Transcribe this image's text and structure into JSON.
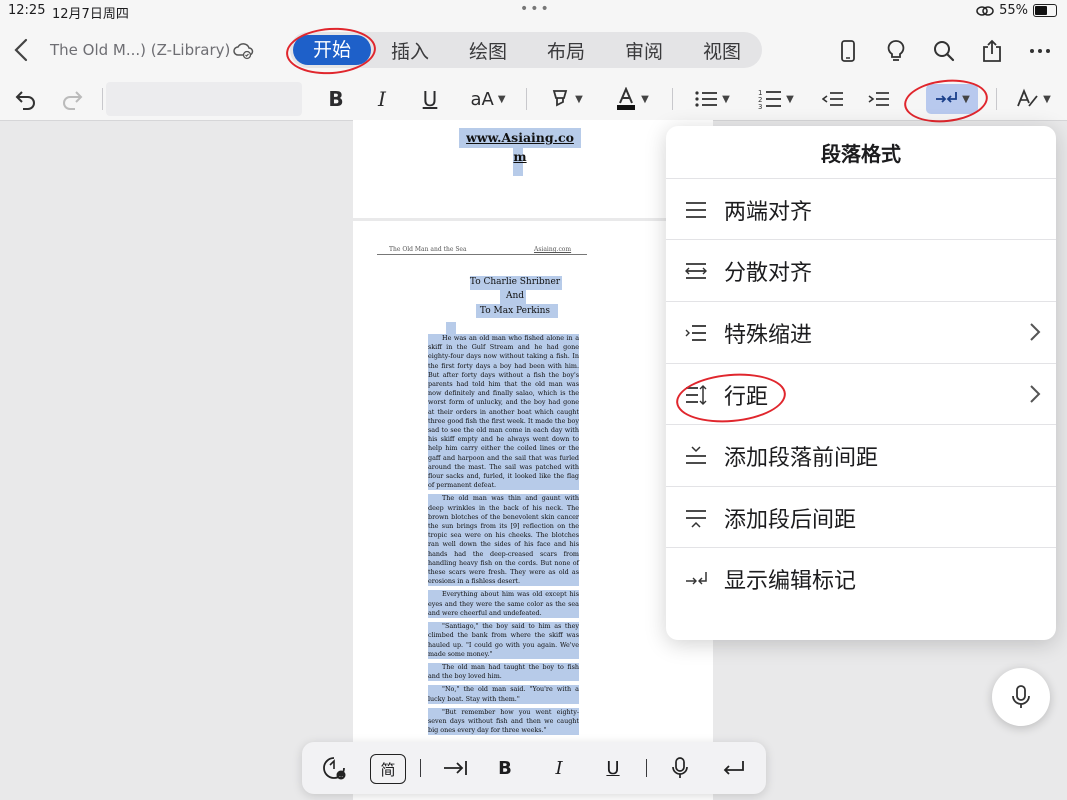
{
  "status_bar": {
    "time": "12:25",
    "date": "12月7日周四",
    "battery": "55%"
  },
  "title_bar": {
    "document_title": "The Old M...) (Z-Library)",
    "tabs": [
      {
        "label": "开始",
        "active": true
      },
      {
        "label": "插入"
      },
      {
        "label": "绘图"
      },
      {
        "label": "布局"
      },
      {
        "label": "审阅"
      },
      {
        "label": "视图"
      }
    ]
  },
  "toolbar": {
    "bold": "B",
    "italic": "I",
    "underline": "U",
    "font_size": "aA"
  },
  "document": {
    "site_link": "www.Asiaing.co m",
    "header_left": "The Old Man and the Sea",
    "header_right": "Asiaing.com",
    "dedication": [
      "To Charlie Shribner",
      "And",
      "To Max Perkins"
    ],
    "paragraphs": [
      "He was an old man who fished alone in a skiff in the Gulf Stream and he had gone eighty-four days now without taking a fish. In the first forty days a boy had been with him. But after forty days without a fish the boy's parents had told him that the old man was now definitely and finally salao, which is the worst form of unlucky, and the boy had gone at their orders in another boat which caught three good fish the first week. It made the boy sad to see the old man come in each day with his skiff empty and he always went down to help him carry either the coiled lines or the gaff and harpoon and the sail that was furled around the mast. The sail was patched with flour sacks and, furled, it looked like the flag of permanent defeat.",
      "The old man was thin and gaunt with deep wrinkles in the back of his neck. The brown blotches of the benevolent skin cancer the sun brings from its [9] reflection on the tropic sea were on his cheeks. The blotches ran well down the sides of his face and his hands had the deep-creased scars from handling heavy fish on the cords. But none of these scars were fresh. They were as old as erosions in a fishless desert.",
      "Everything about him was old except his eyes and they were the same color as the sea and were cheerful and undefeated.",
      "\"Santiago,\" the boy said to him as they climbed the bank from where the skiff was hauled up. \"I could go with you again. We've made some money.\"",
      "The old man had taught the boy to fish and the boy loved him.",
      "\"No,\" the old man said. \"You're with a lucky boat. Stay with them.\"",
      "\"But remember how you went eighty-seven days without fish and then we caught big ones every day for three weeks.\""
    ]
  },
  "paragraph_panel": {
    "title": "段落格式",
    "items": [
      {
        "label": "两端对齐",
        "icon": "justify-icon"
      },
      {
        "label": "分散对齐",
        "icon": "distribute-icon"
      },
      {
        "label": "特殊缩进",
        "icon": "indent-special-icon",
        "has_submenu": true
      },
      {
        "label": "行距",
        "icon": "line-spacing-icon",
        "has_submenu": true
      },
      {
        "label": "添加段落前间距",
        "icon": "space-before-icon"
      },
      {
        "label": "添加段后间距",
        "icon": "space-after-icon"
      },
      {
        "label": "显示编辑标记",
        "icon": "formatting-marks-icon"
      }
    ]
  },
  "keyboard_bar": {
    "simplified": "简",
    "bold": "B",
    "italic": "I",
    "underline": "U"
  },
  "colors": {
    "accent": "#1e60c9",
    "selection": "#b7cbe9",
    "annotation": "#e0262d"
  }
}
